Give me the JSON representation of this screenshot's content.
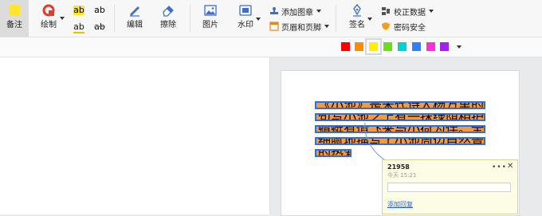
{
  "toolbar": {
    "highlight_label": "备注",
    "draw_label": "绘制",
    "edit_label": "编辑",
    "erase_label": "擦除",
    "image_label": "图片",
    "watermark_label": "水印",
    "add_stamp_label": "添加图章",
    "header_footer_label": "页眉和页脚",
    "sign_label": "签名",
    "proof_data_label": "校正数据",
    "password_label": "密码安全",
    "hl_a": "ab",
    "hl_b": "ab",
    "hl_c": "ab",
    "hl_d": "ab"
  },
  "colors": {
    "swatches": [
      "#ff0000",
      "#ff8c00",
      "#ffee00",
      "#6ddc1a",
      "#00d2d2",
      "#2f80ff",
      "#ff2fd6",
      "#a020f0"
    ],
    "selected": "#ffee00"
  },
  "document": {
    "lines": [
      "《小池》是宋代诗人杨万里的诗作。此诗首句写小池有活水相通，次",
      "句写小池之上有一抹绿荫相护，三句写小荷出水与小蜻相伴，结句写",
      "蜻蜓有情飞来与小荷为伴。全诗运用丰富新颖的想象以及拟人手法，",
      "细腻地描写了小池周边自然景物的特征和变化，表现了诗人对大自然",
      "的热爱之情。"
    ]
  },
  "comment": {
    "user": "21958",
    "time": "今天 15:21",
    "more": "•••",
    "close": "✕",
    "reply": "添加回复"
  }
}
